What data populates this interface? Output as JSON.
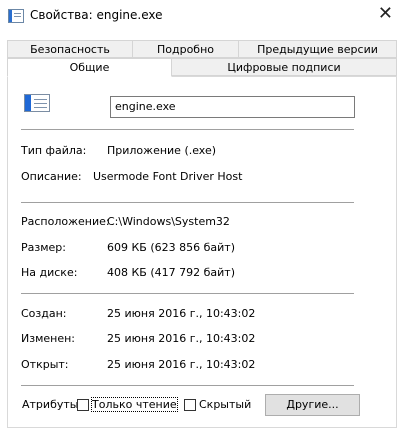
{
  "window": {
    "title": "Свойства: engine.exe",
    "close_glyph": "✕"
  },
  "tabs": {
    "row1": [
      "Безопасность",
      "Подробно",
      "Предыдущие версии"
    ],
    "row2": [
      "Общие",
      "Цифровые подписи"
    ],
    "active": "Общие"
  },
  "general": {
    "file_name": "engine.exe",
    "file_type_label": "Тип файла:",
    "file_type_value": "Приложение (.exe)",
    "description_label": "Описание:",
    "description_value": "Usermode Font Driver Host",
    "location_label": "Расположение:",
    "location_value": "C:\\Windows\\System32",
    "size_label": "Размер:",
    "size_value": "609 КБ (623 856 байт)",
    "disk_label": "На диске:",
    "disk_value": "408 КБ (417 792 байт)",
    "created_label": "Создан:",
    "created_value": "25 июня 2016 г., 10:43:02",
    "modified_label": "Изменен:",
    "modified_value": "25 июня 2016 г., 10:43:02",
    "opened_label": "Открыт:",
    "opened_value": "25 июня 2016 г., 10:43:02",
    "attributes_label": "Атрибуты:",
    "readonly_label": "Только чтение",
    "hidden_label": "Скрытый",
    "other_button": "Другие..."
  },
  "icons": {
    "app": "exe-window-icon",
    "file": "exe-window-icon"
  },
  "colors": {
    "icon_blue": "#1f68d6",
    "border": "#d9d9d9"
  }
}
